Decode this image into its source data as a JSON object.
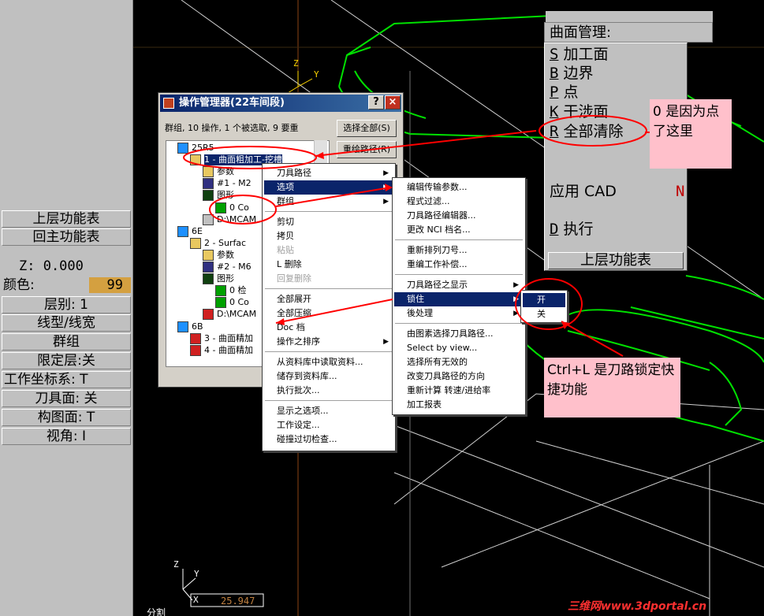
{
  "left_panel": {
    "items": [
      {
        "label": "上层功能表",
        "type": "button"
      },
      {
        "label": "回主功能表",
        "type": "button"
      },
      {
        "label": "Z:    0.000",
        "type": "row"
      },
      {
        "label": "颜色:",
        "value": "99",
        "type": "row"
      },
      {
        "label": "层别:  1",
        "type": "button"
      },
      {
        "label": "线型/线宽",
        "type": "button"
      },
      {
        "label": "群组",
        "type": "button"
      },
      {
        "label": "限定层:关",
        "type": "button"
      },
      {
        "label": "工作坐标系:   T",
        "type": "button"
      },
      {
        "label": "刀具面: 关",
        "type": "button"
      },
      {
        "label": "构图面:  T",
        "type": "button"
      },
      {
        "label": "视角:   I",
        "type": "button"
      }
    ]
  },
  "op_manager": {
    "title": "操作管理器(22车间段)",
    "help_btn": "?",
    "close_btn": "×",
    "status": "群组, 10 操作, 1 个被选取, 9  要重",
    "select_all": "选择全部(S)",
    "regen": "重绘路径(R)",
    "tree": [
      {
        "text": "25R5",
        "indent": 1,
        "icon": "group"
      },
      {
        "text": "1 - 曲面粗加工-挖槽",
        "indent": 2,
        "icon": "folder-open",
        "selected": true
      },
      {
        "text": "参数",
        "indent": 3,
        "icon": "folder"
      },
      {
        "text": "#1 - M2",
        "indent": 3,
        "icon": "tool"
      },
      {
        "text": "图形",
        "indent": 3,
        "icon": "geometry"
      },
      {
        "text": "0 Co",
        "indent": 4,
        "icon": "nc"
      },
      {
        "text": "D:\\MCAM",
        "indent": 3,
        "icon": "file"
      },
      {
        "text": "6E",
        "indent": 1,
        "icon": "group"
      },
      {
        "text": "2 - Surfac",
        "indent": 2,
        "icon": "folder-open"
      },
      {
        "text": "参数",
        "indent": 3,
        "icon": "folder"
      },
      {
        "text": "#2 - M6",
        "indent": 3,
        "icon": "tool"
      },
      {
        "text": "图形",
        "indent": 3,
        "icon": "geometry"
      },
      {
        "text": "0 检",
        "indent": 4,
        "icon": "nc"
      },
      {
        "text": "0 Co",
        "indent": 4,
        "icon": "nc"
      },
      {
        "text": "D:\\MCAM",
        "indent": 3,
        "icon": "x-file"
      },
      {
        "text": "6B",
        "indent": 1,
        "icon": "group"
      },
      {
        "text": "3 - 曲面精加",
        "indent": 2,
        "icon": "x-op"
      },
      {
        "text": "4 - 曲面精加",
        "indent": 2,
        "icon": "x-op"
      }
    ]
  },
  "context_menu": {
    "items": [
      {
        "label": "刀具路径",
        "sub": true
      },
      {
        "label": "选项",
        "sub": true,
        "selected": true
      },
      {
        "label": "群组",
        "sub": true
      },
      {
        "sep": true
      },
      {
        "label": "剪切"
      },
      {
        "label": "拷贝"
      },
      {
        "label": "粘贴",
        "disabled": true
      },
      {
        "label": "L 删除"
      },
      {
        "label": "回复删除",
        "disabled": true
      },
      {
        "sep": true
      },
      {
        "label": "全部展开"
      },
      {
        "label": "全部压缩"
      },
      {
        "label": "Doc 档"
      },
      {
        "label": "操作之排序",
        "sub": true
      },
      {
        "sep": true
      },
      {
        "label": "从资料库中读取资料..."
      },
      {
        "label": "储存到资料库..."
      },
      {
        "label": "执行批次..."
      },
      {
        "sep": true
      },
      {
        "label": "显示之选项..."
      },
      {
        "label": "工作设定..."
      },
      {
        "label": "碰撞过切检查..."
      }
    ]
  },
  "options_menu": {
    "items": [
      {
        "label": "编辑传输参数..."
      },
      {
        "label": "程式过滤..."
      },
      {
        "label": "刀具路径编辑器..."
      },
      {
        "label": "更改 NCI 档名..."
      },
      {
        "sep": true
      },
      {
        "label": "重新排列刀号..."
      },
      {
        "label": "重编工作补偿..."
      },
      {
        "sep": true
      },
      {
        "label": "刀具路径之显示",
        "sub": true
      },
      {
        "label": "锁住",
        "sub": true,
        "selected": true
      },
      {
        "label": "後处理",
        "sub": true
      },
      {
        "sep": true
      },
      {
        "label": "由图素选择刀具路径..."
      },
      {
        "label": "Select by view..."
      },
      {
        "label": "选择所有无效的"
      },
      {
        "label": "改变刀具路径的方向"
      },
      {
        "label": "重新计算 转速/进给率"
      },
      {
        "label": "加工报表"
      }
    ]
  },
  "lock_menu": {
    "items": [
      {
        "label": "开",
        "selected": true
      },
      {
        "label": "关"
      }
    ]
  },
  "surface_menu": {
    "title": "曲面管理:",
    "items": [
      {
        "key": "S",
        "label": "加工面"
      },
      {
        "key": "B",
        "label": "边界"
      },
      {
        "key": "P",
        "label": "点"
      },
      {
        "key": "K",
        "label": "干涉面"
      },
      {
        "key": "R",
        "label": "全部清除"
      }
    ],
    "apply_label": "应用 CAD",
    "apply_value": "N",
    "exec_key": "D",
    "exec_label": "执行",
    "upper": "上层功能表"
  },
  "notes": {
    "note1": "0 是因为点了这里",
    "note2": "Ctrl+L 是刀路锁定快捷功能"
  },
  "viewport": {
    "axis_top": {
      "z": "Z",
      "y": "Y"
    },
    "axis_bottom": {
      "z": "Z",
      "y": "Y",
      "x": "X"
    },
    "readout": "25.947",
    "bottom_label": "分割",
    "watermark": "三维网www.3dportal.cn"
  },
  "colors": {
    "accent": "#0a246a",
    "annotation": "#ff0000",
    "wire": "#00ff00",
    "note_bg": "#ffc0cb"
  }
}
